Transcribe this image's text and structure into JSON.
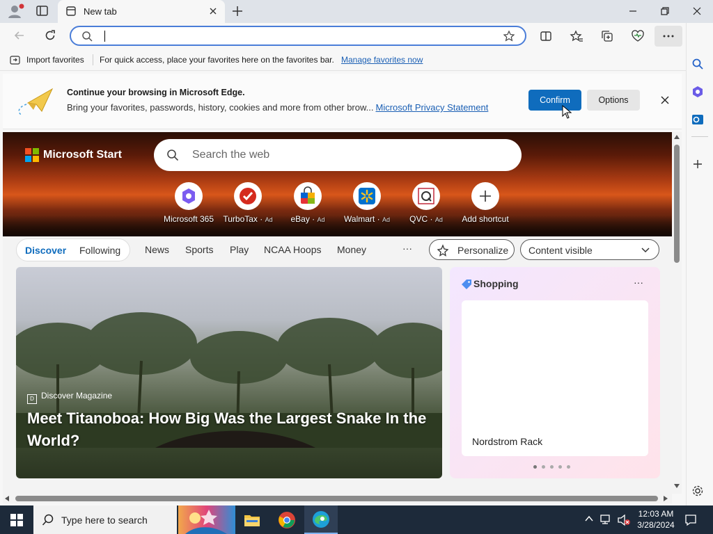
{
  "tab": {
    "title": "New tab"
  },
  "address": {
    "value": "",
    "placeholder": ""
  },
  "favorites_bar": {
    "import_label": "Import favorites",
    "hint": "For quick access, place your favorites here on the favorites bar.",
    "manage_link": "Manage favorites now"
  },
  "banner": {
    "title": "Continue your browsing in Microsoft Edge.",
    "body": "Bring your favorites, passwords, history, cookies and more from other brow...",
    "privacy_link": "Microsoft Privacy Statement",
    "confirm_label": "Confirm",
    "options_label": "Options"
  },
  "start": {
    "brand": "Microsoft Start",
    "search_placeholder": "Search the web",
    "shortcuts": [
      {
        "label": "Microsoft 365",
        "ad": ""
      },
      {
        "label": "TurboTax",
        "ad": "Ad"
      },
      {
        "label": "eBay",
        "ad": "Ad"
      },
      {
        "label": "Walmart",
        "ad": "Ad"
      },
      {
        "label": "QVC",
        "ad": "Ad"
      },
      {
        "label": "Add shortcut",
        "ad": ""
      }
    ]
  },
  "feed_nav": {
    "discover": "Discover",
    "following": "Following",
    "items": [
      "News",
      "Sports",
      "Play",
      "NCAA Hoops",
      "Money"
    ],
    "more": "···",
    "personalize": "Personalize",
    "content_visible": "Content visible"
  },
  "main_card": {
    "source": "Discover Magazine",
    "headline": "Meet Titanoboa: How Big Was the Largest Snake In the World?"
  },
  "shopping_card": {
    "title": "Shopping",
    "more": "···",
    "item_name": "Nordstrom Rack",
    "page_count": 5,
    "active_page": 1
  },
  "taskbar": {
    "search_placeholder": "Type here to search",
    "time": "12:03 AM",
    "date": "3/28/2024"
  },
  "colors": {
    "accent": "#0f6cbd",
    "address_border": "#4a7dd8",
    "taskbar": "#1d2a3a"
  }
}
